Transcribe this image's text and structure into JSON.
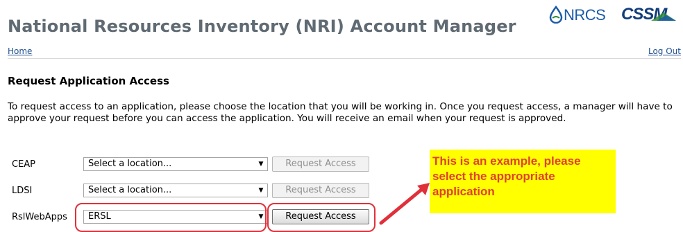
{
  "header": {
    "title": "National Resources Inventory (NRI) Account Manager",
    "logo_nrcs": "NRCS",
    "logo_cssm": "CSSM"
  },
  "nav": {
    "home": "Home",
    "logout": "Log Out"
  },
  "main": {
    "heading": "Request Application Access",
    "intro": "To request access to an application, please choose the location that you will be working in. Once you request access, a manager will have to approve your request before you can access the application. You will receive an email when your request is approved.",
    "rows": [
      {
        "app": "CEAP",
        "location": "Select a location...",
        "button": "Request Access",
        "enabled": false
      },
      {
        "app": "LDSI",
        "location": "Select a location...",
        "button": "Request Access",
        "enabled": false
      },
      {
        "app": "RslWebApps",
        "location": "ERSL",
        "button": "Request Access",
        "enabled": true
      }
    ]
  },
  "annotation": {
    "note": "This is an example, please select the appropriate application"
  },
  "colors": {
    "title": "#5f6a73",
    "link": "#1f4f8f",
    "annotation_bg": "#ffff00",
    "annotation_text": "#e0402a",
    "highlight": "#e0303a"
  }
}
